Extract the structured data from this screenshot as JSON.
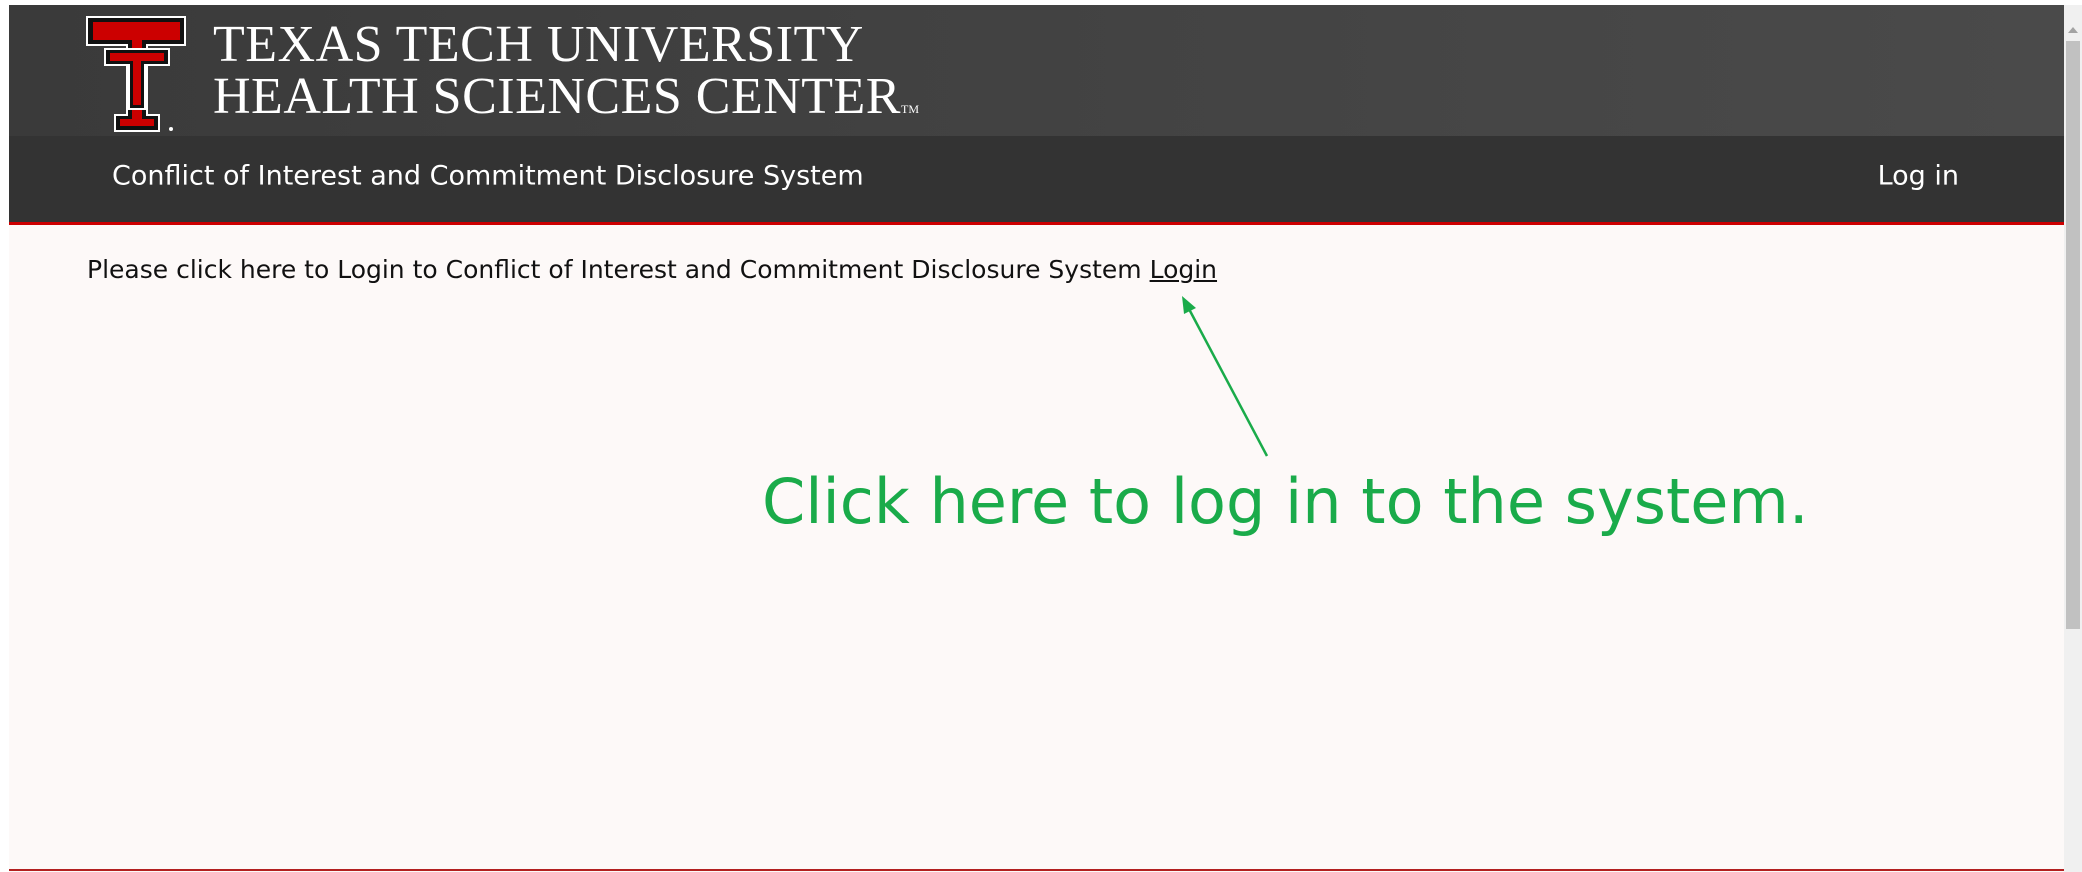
{
  "brand": {
    "line1": "TEXAS TECH UNIVERSITY",
    "line2": "HEALTH SCIENCES CENTER",
    "trademark": "TM",
    "colors": {
      "red": "#cc0000",
      "header_bg": "#434343",
      "nav_bg": "#333333"
    }
  },
  "navbar": {
    "title": "Conflict of Interest and Commitment Disclosure System",
    "login_label": "Log in"
  },
  "main": {
    "instruction": "Please click here to Login to Conflict of Interest and Commitment Disclosure System ",
    "login_link": "Login"
  },
  "annotation": {
    "text": "Click here to log in to the system.",
    "color": "#1aab4a"
  }
}
